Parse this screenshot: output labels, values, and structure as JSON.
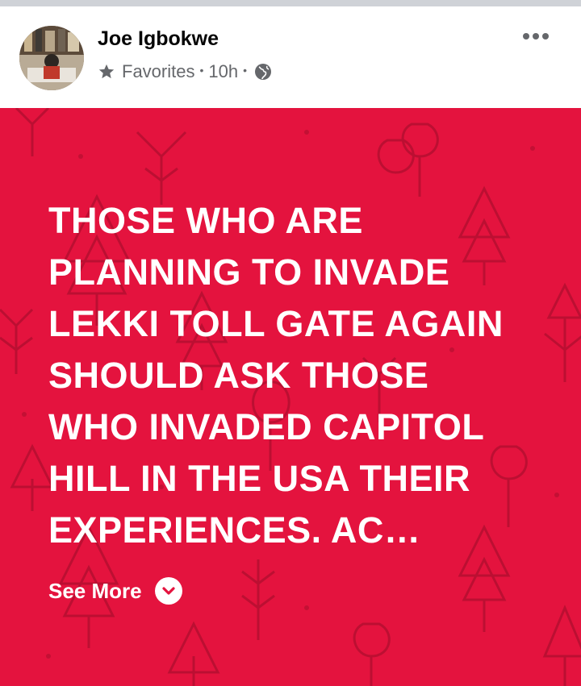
{
  "post": {
    "author": "Joe Igbokwe",
    "audience": "Favorites",
    "separator": "•",
    "time": "10h",
    "body_text": "THOSE WHO ARE\nPLANNING TO INVADE\nLEKKI TOLL GATE AGAIN\nSHOULD ASK THOSE\nWHO INVADED CAPITOL\nHILL IN THE USA  THEIR\nEXPERIENCES. AC…",
    "see_more_label": "See More",
    "icons": {
      "audience": "star-icon",
      "privacy": "globe-icon",
      "menu": "more-options-icon",
      "expand": "chevron-down-icon"
    },
    "colors": {
      "background": "#e4133e",
      "text": "#ffffff",
      "pattern": "#b50f30"
    }
  }
}
